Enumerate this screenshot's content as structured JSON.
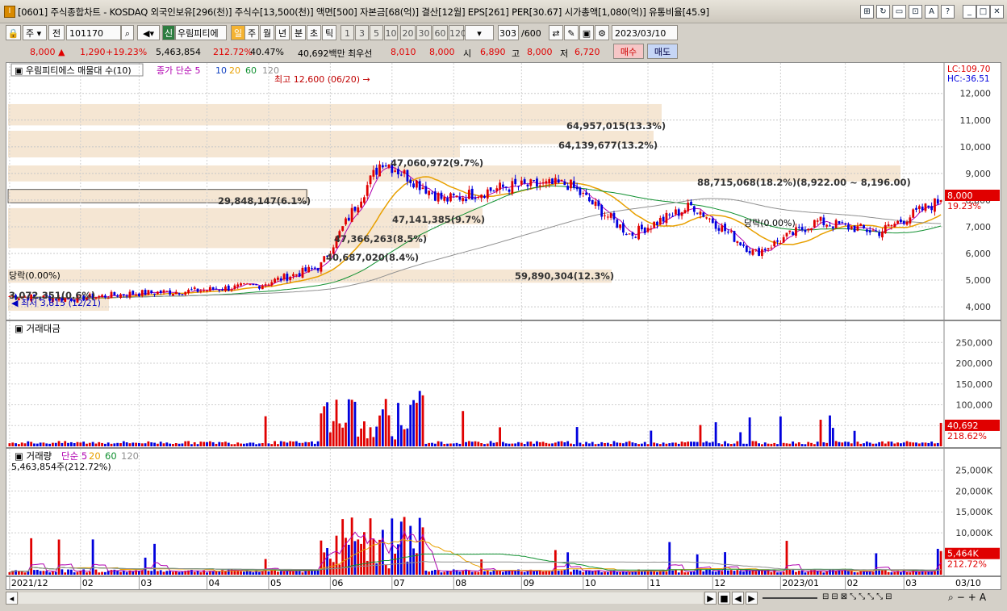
{
  "window": {
    "title": "[0601] 주식종합차트 - KOSDAQ 외국인보유[296(천)] 주식수[13,500(천)] 액면[500] 자본금[68(억)] 결산[12월] EPS[261] PER[30.67] 시가총액[1,080(억)] 유통비율[45.9]",
    "app_icon": "I"
  },
  "toolbar": {
    "type_label": "주",
    "prev_label": "전",
    "code": "101170",
    "badge": "신",
    "stock_name": "우림피티에스",
    "periods": [
      "일",
      "주",
      "월",
      "년",
      "분",
      "초",
      "틱"
    ],
    "selected_period": "일",
    "intervals": [
      "1",
      "3",
      "5",
      "10",
      "20",
      "30",
      "60",
      "120"
    ],
    "count_value": "303",
    "count_total": "/600",
    "date": "2023/03/10"
  },
  "quote": {
    "price": "8,000",
    "change": "1,290",
    "change_rate": "+19.23%",
    "volume": "5,463,854",
    "volume_rate": "212.72%",
    "turnover": "40.47%",
    "amount": "40,692백만",
    "priority_label": "최우선",
    "ask": "8,010",
    "bid": "8,000",
    "open_label": "시",
    "open": "6,890",
    "high_label": "고",
    "high": "8,000",
    "low_label": "저",
    "low": "6,720",
    "buy_label": "매수",
    "sell_label": "매도"
  },
  "colors": {
    "up": "#e00000",
    "down": "#0000dd",
    "ma5": "#b000b0",
    "ma10": "#1040c0",
    "ma20": "#e8a000",
    "ma60": "#109030",
    "ma120": "#909090",
    "volume_profile": "#f5e6d3"
  },
  "price_pane": {
    "legend_name": "우림피티에스 매물대 수(10)",
    "ma_legend": [
      "종가 단순 5",
      "10",
      "20",
      "60",
      "120"
    ],
    "lc": "LC:109.70",
    "hc": "HC:-36.51",
    "high_marker": "최고 12,600 (06/20)",
    "low_marker": "최저 3,815 (12/21)",
    "current_tag": "8,000",
    "current_pct": "19.23%",
    "profile_labels": [
      "64,957,015(13.3%)",
      "64,139,677(13.2%)",
      "88,715,068(18.2%)(8,922.00 ~ 8,196.00)",
      "47,060,972(9.7%)",
      "29,848,147(6.1%)",
      "47,141,385(9.7%)",
      "47,366,263(8.5%)",
      "40,687,020(8.4%)",
      "59,890,304(12.3%)",
      "3,072,351(0.6%)"
    ],
    "markers": [
      "당락(0.00%)",
      "당락(0.00%)"
    ],
    "y_ticks": [
      "12,000",
      "11,000",
      "10,000",
      "9,000",
      "8,000",
      "7,000",
      "6,000",
      "5,000",
      "4,000"
    ]
  },
  "amount_pane": {
    "legend": "거래대금",
    "y_ticks": [
      "250,000",
      "200,000",
      "150,000",
      "100,000",
      "50,000"
    ],
    "current_tag": "40,692",
    "current_pct": "218.62%"
  },
  "volume_pane": {
    "legend": [
      "거래량",
      "단순 5",
      "20",
      "60",
      "120"
    ],
    "sub_legend": "5,463,854주(212.72%)",
    "y_ticks": [
      "25,000K",
      "20,000K",
      "15,000K",
      "10,000K",
      "5,000K"
    ],
    "current_tag": "5,464K",
    "current_pct": "212.72%"
  },
  "x_axis": {
    "labels": [
      "2021/12",
      "02",
      "03",
      "04",
      "05",
      "06",
      "07",
      "08",
      "09",
      "10",
      "11",
      "12",
      "2023/01",
      "02",
      "03"
    ],
    "last_date": "03/10"
  },
  "chart_data": {
    "type": "candlestick",
    "period": "2021/12 ~ 2023/03/10",
    "price_high": 12600,
    "price_high_date": "06/20",
    "price_low": 3815,
    "price_low_date": "12/21",
    "last_close": 8000,
    "monthly_closes": [
      {
        "month": "2021/12",
        "close": 4400
      },
      {
        "month": "2022/01",
        "close": 4300
      },
      {
        "month": "2022/02",
        "close": 4500
      },
      {
        "month": "2022/03",
        "close": 4600
      },
      {
        "month": "2022/04",
        "close": 4800
      },
      {
        "month": "2022/05",
        "close": 5500
      },
      {
        "month": "2022/06",
        "close": 9500
      },
      {
        "month": "2022/07",
        "close": 8000
      },
      {
        "month": "2022/08",
        "close": 8500
      },
      {
        "month": "2022/09",
        "close": 8600
      },
      {
        "month": "2022/10",
        "close": 6700
      },
      {
        "month": "2022/11",
        "close": 7800
      },
      {
        "month": "2022/12",
        "close": 6000
      },
      {
        "month": "2023/01",
        "close": 7200
      },
      {
        "month": "2023/02",
        "close": 6800
      },
      {
        "month": "2023/03",
        "close": 8000
      }
    ],
    "price_ylim": [
      3700,
      12900
    ],
    "amount_ylim": [
      0,
      270000
    ],
    "volume_ylim": [
      0,
      27000000
    ]
  }
}
